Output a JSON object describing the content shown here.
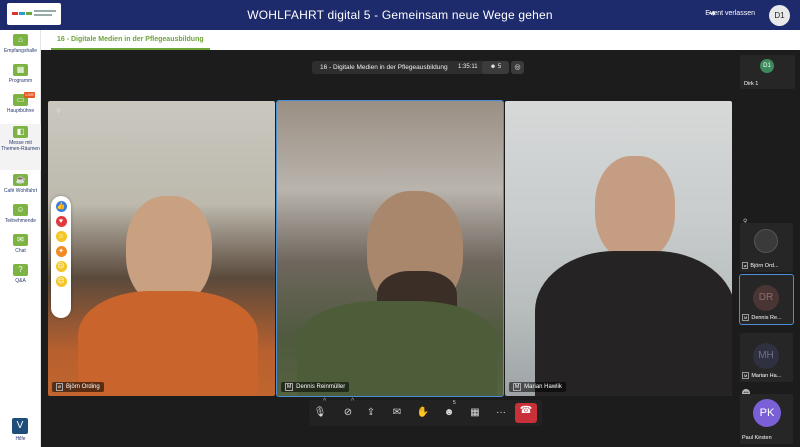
{
  "header": {
    "title": "WOHLFAHRT digital 5 - Gemeinsam neue Wege gehen",
    "leave_label": "Event verlassen",
    "user_initials": "D1"
  },
  "sidebar": {
    "items": [
      {
        "label": "Empfangshalle",
        "icon": "reception-icon"
      },
      {
        "label": "Programm",
        "icon": "calendar-icon"
      },
      {
        "label": "Hauptbühne",
        "icon": "stage-icon",
        "badge": "LIVE"
      },
      {
        "label": "Messe mit Themen-Räumen",
        "icon": "fair-icon"
      },
      {
        "label": "Café Wohlfahrt",
        "icon": "cafe-icon"
      },
      {
        "label": "Teilnehmende",
        "icon": "people-icon"
      },
      {
        "label": "Chat",
        "icon": "chat-icon"
      },
      {
        "label": "Q&A",
        "icon": "qa-icon"
      }
    ],
    "help_label": "Hilfe"
  },
  "tab": {
    "label": "16 - Digitale Medien in der Pflegeausbildung"
  },
  "meeting": {
    "title": "16 - Digitale Medien in der Pflegeausbildung",
    "timer": "1:35:11",
    "participant_count": "5"
  },
  "tiles": [
    {
      "name": "Björn Ording"
    },
    {
      "name": "Dennis Reinmüller"
    },
    {
      "name": "Marian Hawlik"
    }
  ],
  "rail": {
    "top": {
      "name": "Dirk 1",
      "initials": "D1"
    },
    "thumbs": [
      {
        "name": "Björn Ord..."
      },
      {
        "name": "Dennis Re...",
        "initials": "DR"
      },
      {
        "name": "Marian Ha...",
        "initials": "MH"
      },
      {
        "name": "Paul Kirsten",
        "initials": "PK"
      }
    ]
  },
  "toolbar": {
    "raise_hand_count": "5"
  },
  "colors": {
    "header_bg": "#1d2a6b",
    "accent_green": "#7cb342",
    "hangup_red": "#c8303a",
    "active_border": "#4a8fd6"
  }
}
